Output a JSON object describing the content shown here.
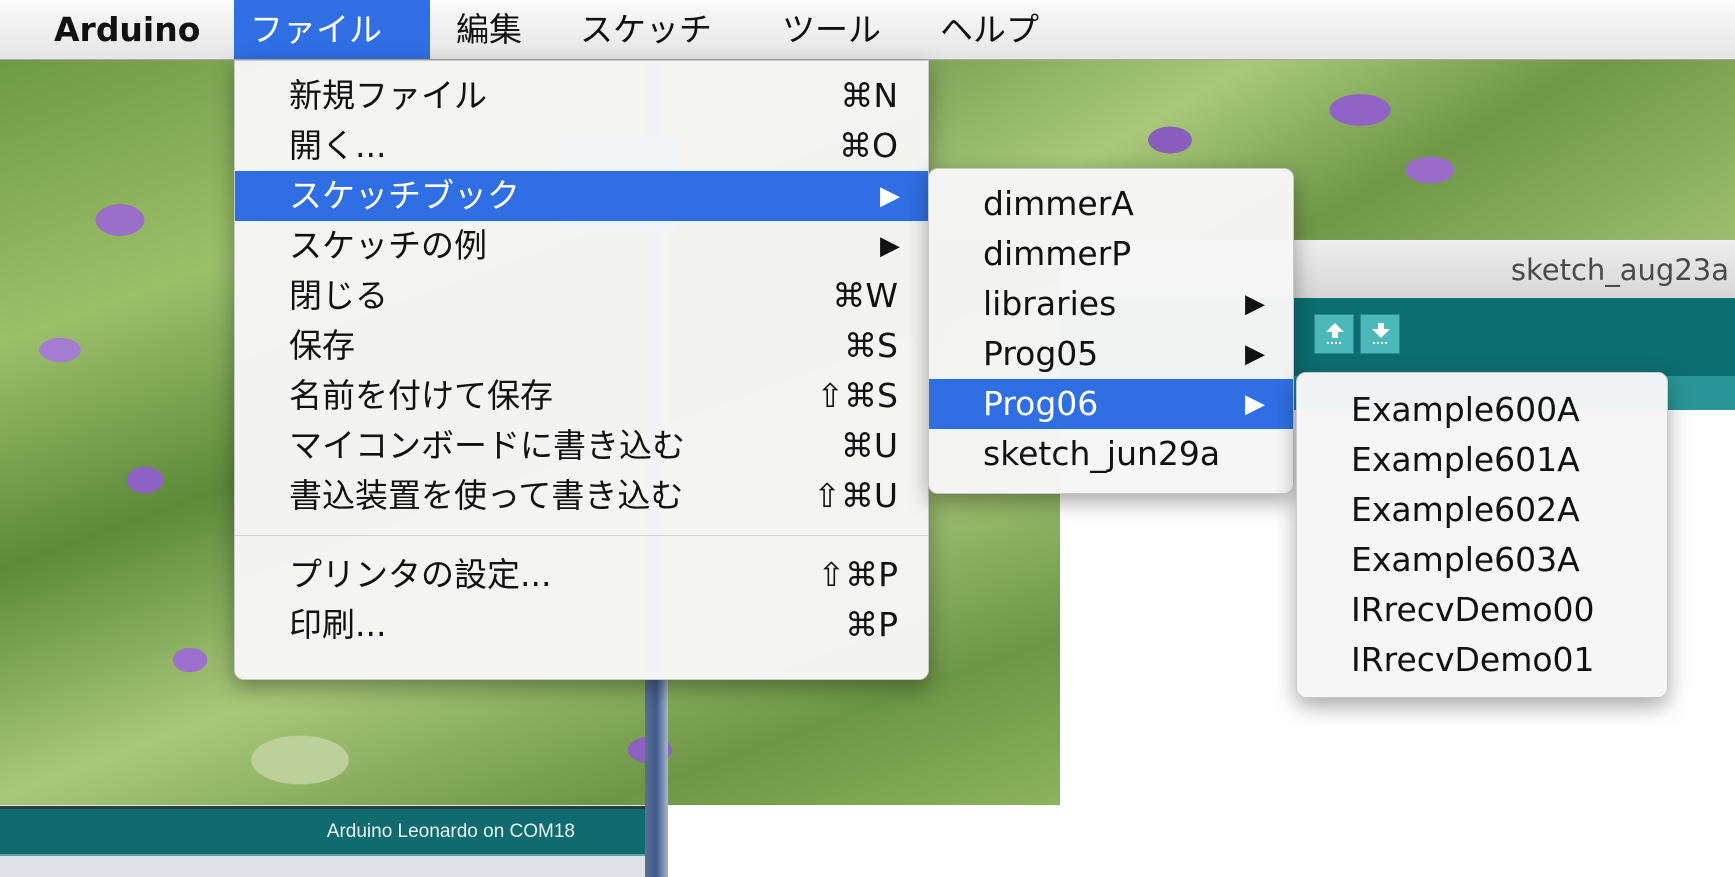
{
  "menubar": {
    "app": "Arduino",
    "items": [
      "ファイル",
      "編集",
      "スケッチ",
      "ツール",
      "ヘルプ"
    ]
  },
  "file_menu": {
    "items": [
      {
        "label": "新規ファイル",
        "shortcut": "⌘N"
      },
      {
        "label": "開く...",
        "shortcut": "⌘O"
      },
      {
        "label": "スケッチブック",
        "shortcut": "▶"
      },
      {
        "label": "スケッチの例",
        "shortcut": "▶"
      },
      {
        "label": "閉じる",
        "shortcut": "⌘W"
      },
      {
        "label": "保存",
        "shortcut": "⌘S"
      },
      {
        "label": "名前を付けて保存",
        "shortcut": "⇧⌘S"
      },
      {
        "label": "マイコンボードに書き込む",
        "shortcut": "⌘U"
      },
      {
        "label": "書込装置を使って書き込む",
        "shortcut": "⇧⌘U"
      },
      {
        "label": "プリンタの設定...",
        "shortcut": "⇧⌘P"
      },
      {
        "label": "印刷...",
        "shortcut": "⌘P"
      }
    ],
    "selected": "スケッチブック"
  },
  "sketchbook_menu": {
    "items": [
      {
        "label": "dimmerA",
        "submenu": ""
      },
      {
        "label": "dimmerP",
        "submenu": ""
      },
      {
        "label": "libraries",
        "submenu": "▶"
      },
      {
        "label": "Prog05",
        "submenu": "▶"
      },
      {
        "label": "Prog06",
        "submenu": "▶"
      },
      {
        "label": "sketch_jun29a",
        "submenu": ""
      }
    ],
    "selected": "Prog06"
  },
  "prog06_menu": {
    "items": [
      "Example600A",
      "Example601A",
      "Example602A",
      "Example603A",
      "IRrecvDemo00",
      "IRrecvDemo01"
    ]
  },
  "sketch_window": {
    "title": "sketch_aug23a"
  },
  "back_window": {
    "status": "Arduino Leonardo on COM18"
  },
  "colors": {
    "selection": "#2f6fe3",
    "toolbar": "#0c6e70",
    "status_bar": "#0f6b6d"
  },
  "icons": {
    "open": "arrow-up-icon",
    "save": "arrow-down-icon",
    "submenu": "triangle-right-icon"
  }
}
